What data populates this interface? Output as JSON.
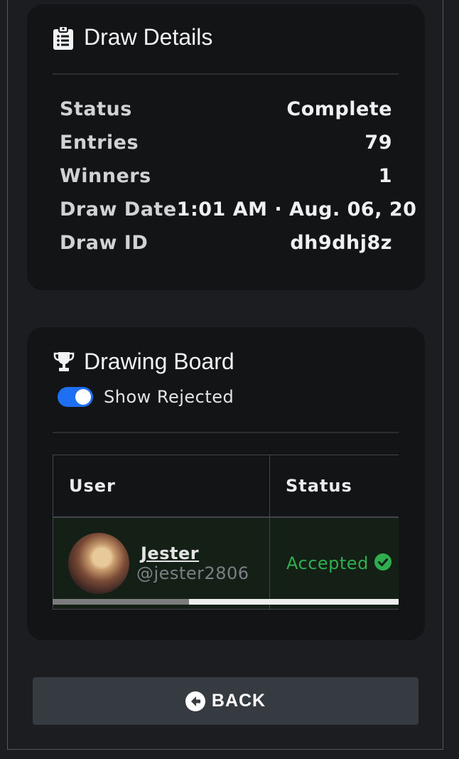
{
  "draw_details": {
    "title": "Draw Details",
    "icon": "clipboard-list-icon",
    "rows": [
      {
        "label": "Status",
        "value": "Complete"
      },
      {
        "label": "Entries",
        "value": "79"
      },
      {
        "label": "Winners",
        "value": "1"
      },
      {
        "label": "Draw Date",
        "value": "1:01 AM · Aug. 06, 20"
      },
      {
        "label": "Draw ID",
        "value": "dh9dhj8z"
      }
    ]
  },
  "drawing_board": {
    "title": "Drawing Board",
    "icon": "trophy-icon",
    "toggle": {
      "label": "Show Rejected",
      "on": true
    },
    "table": {
      "columns": [
        "User",
        "Status"
      ],
      "rows": [
        {
          "name": "Jester",
          "handle": "@jester2806",
          "status": "Accepted",
          "status_icon": "check-circle-icon"
        }
      ]
    },
    "scroll_position": 0.0
  },
  "back_button": {
    "label": "BACK",
    "icon": "arrow-left-circle-icon"
  },
  "colors": {
    "background": "#1c1d20",
    "card": "#131416",
    "accent": "#1f6ff2",
    "accepted": "#2fad4f",
    "accepted_row": "#142016",
    "button": "#363a41"
  }
}
